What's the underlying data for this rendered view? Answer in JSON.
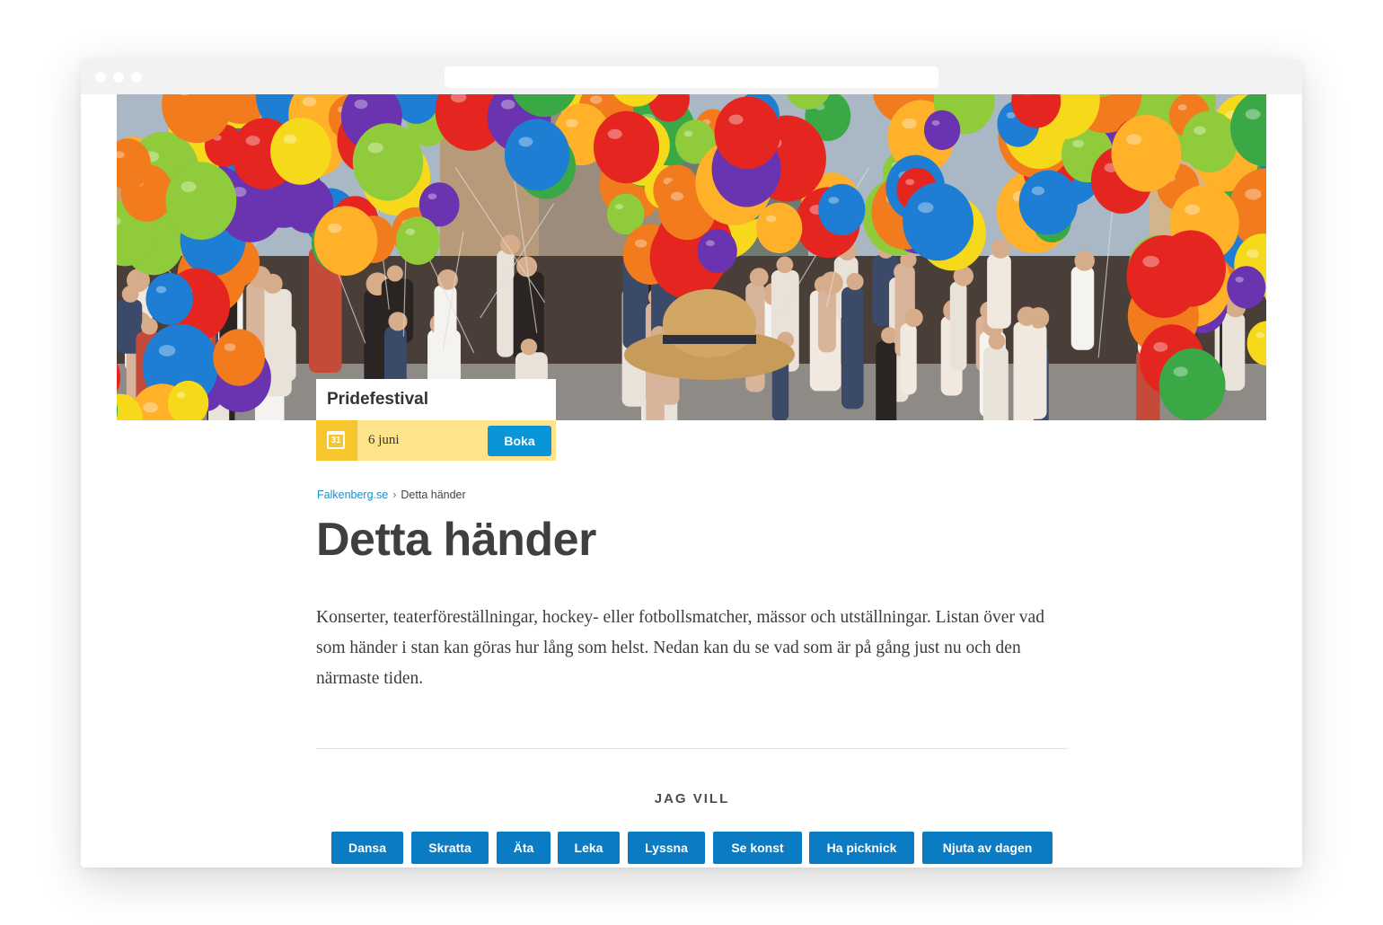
{
  "event": {
    "title": "Pridefestival",
    "calendar_day": "31",
    "date": "6 juni",
    "book_label": "Boka"
  },
  "breadcrumb": {
    "home": "Falkenberg.se",
    "separator": "›",
    "current": "Detta händer"
  },
  "page": {
    "title": "Detta händer",
    "intro": "Konserter, teaterföreställningar, hockey- eller fotbollsmatcher, mässor och utställningar. Listan över vad som händer i stan kan göras hur lång som helst. Nedan kan du se vad som är på gång just nu och den närmaste tiden."
  },
  "activities": {
    "heading": "JAG VILL",
    "items": [
      "Dansa",
      "Skratta",
      "Äta",
      "Leka",
      "Lyssna",
      "Se konst",
      "Ha picknick",
      "Njuta av dagen"
    ]
  },
  "colors": {
    "accent": "#0b7cc4",
    "event_bar": "#ffe38a",
    "calendar": "#f7c52c",
    "link": "#1a8fd1"
  }
}
